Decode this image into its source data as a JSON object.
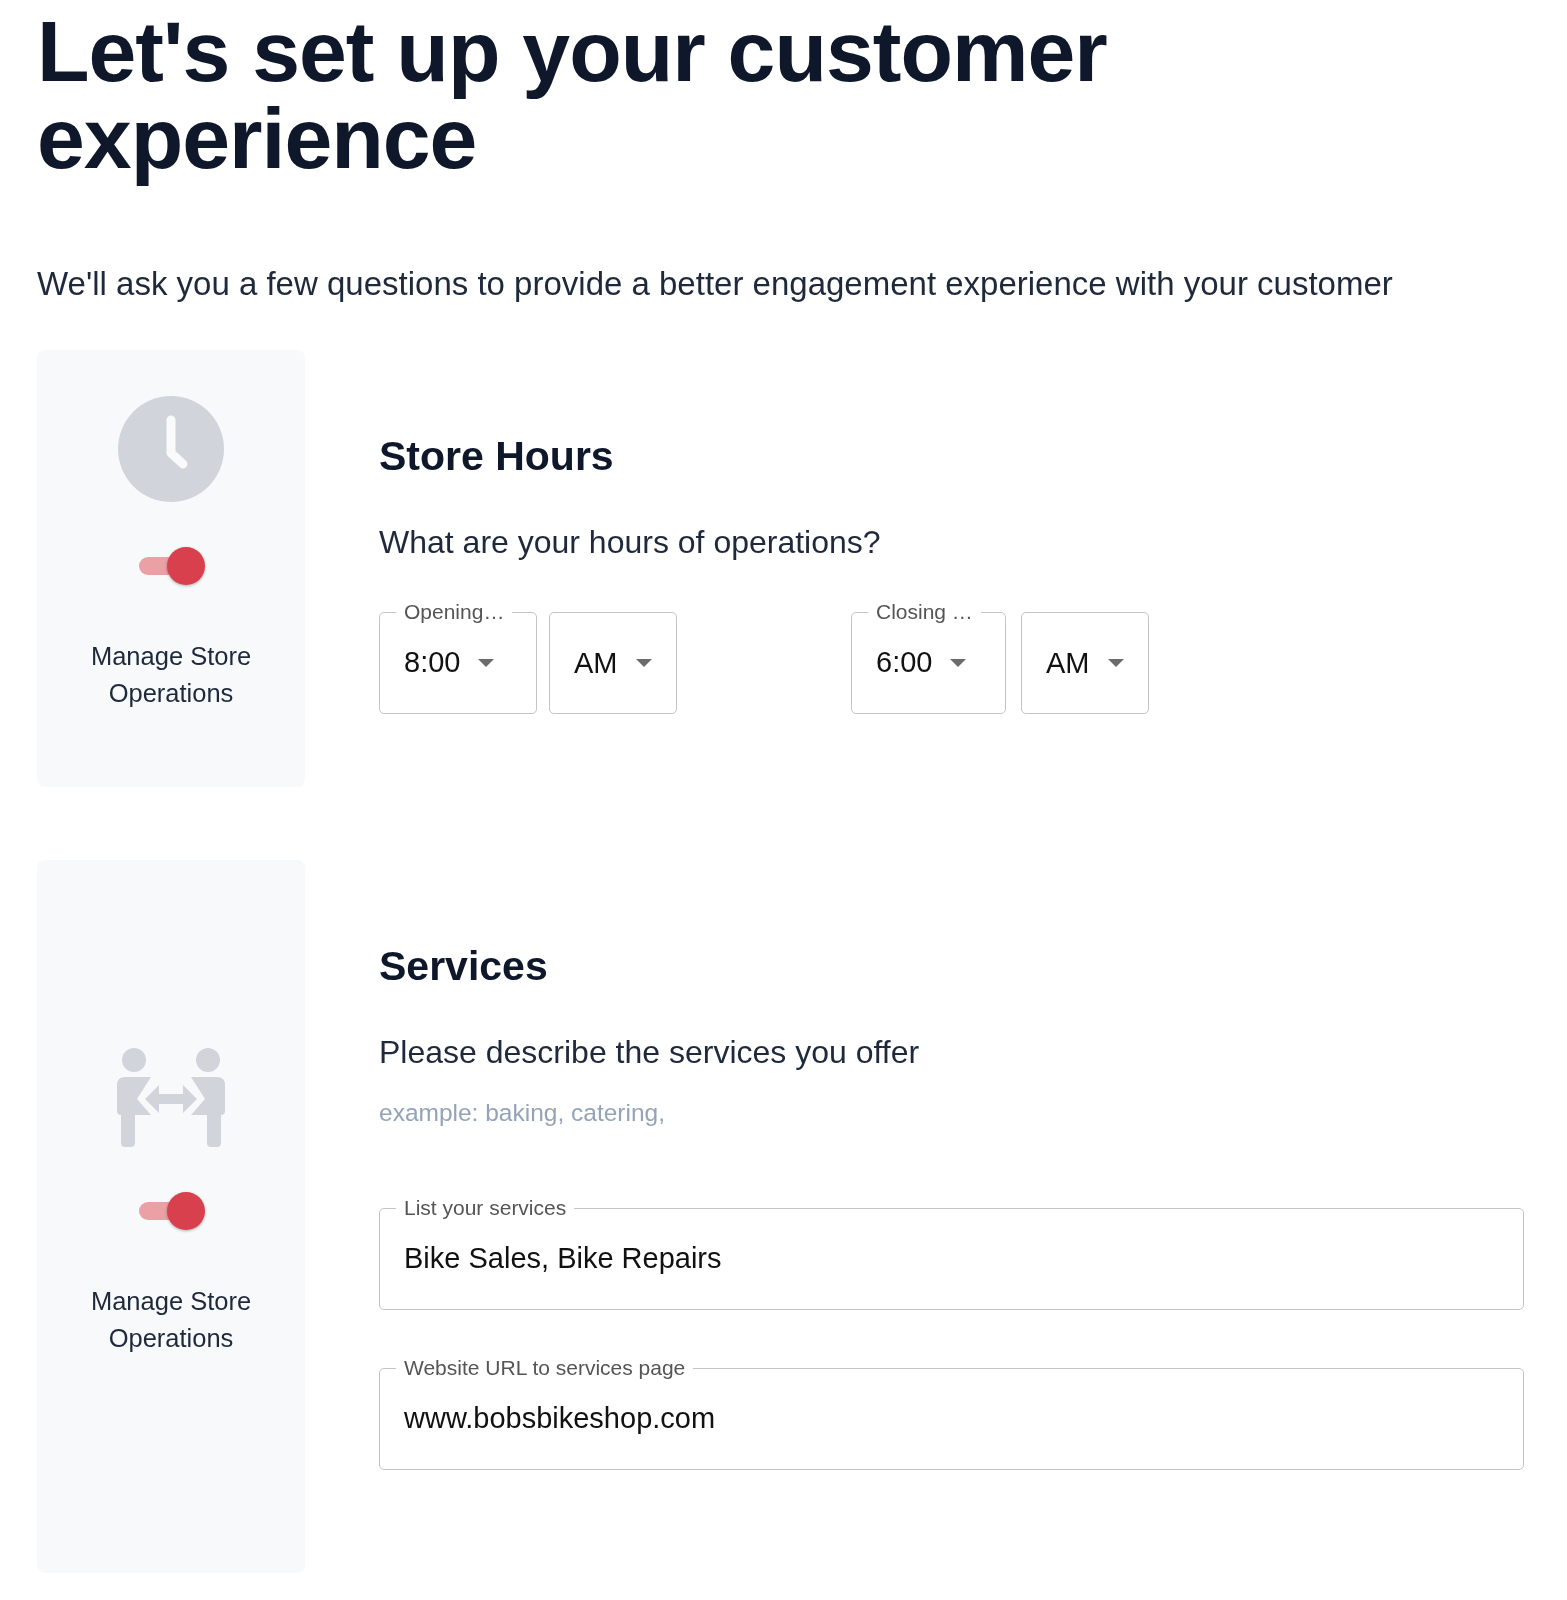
{
  "title": "Let's set up your customer experience",
  "subtitle": "We'll ask you a few questions to provide a better engagement experience with your customer",
  "sections": [
    {
      "kind": "hours",
      "toggle": {
        "on": true
      },
      "card_label": "Manage Store Operations",
      "heading": "Store Hours",
      "question": "What are your hours of operations?",
      "fields": [
        {
          "kind": "select",
          "label": "Opening…",
          "value": "8:00"
        },
        {
          "kind": "select",
          "value": "AM"
        },
        {
          "kind": "select",
          "label": "Closing …",
          "value": "6:00"
        },
        {
          "kind": "select",
          "value": "AM"
        }
      ]
    },
    {
      "kind": "services",
      "toggle": {
        "on": true
      },
      "card_label": "Manage Store Operations",
      "heading": "Services",
      "question": "Please describe the services you offer",
      "hint": "example: baking, catering,",
      "fields": [
        {
          "kind": "text",
          "label": "List your services",
          "value": "Bike Sales, Bike Repairs"
        },
        {
          "kind": "text",
          "label": "Website URL to services page",
          "value": "www.bobsbikeshop.com"
        }
      ]
    }
  ]
}
